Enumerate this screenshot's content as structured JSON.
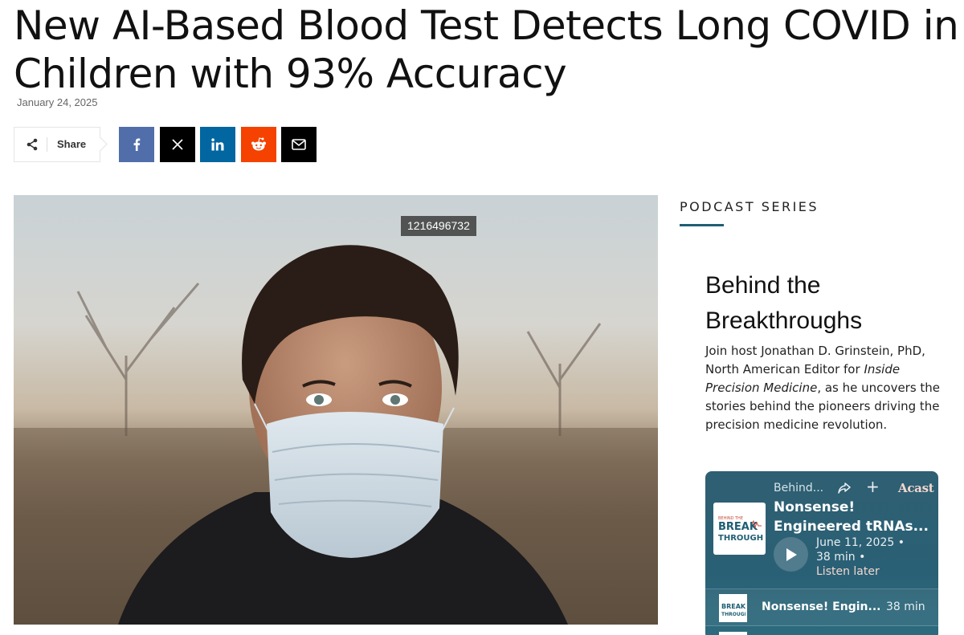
{
  "article": {
    "headline": "New AI-Based Blood Test Detects Long COVID in Children with 93% Accuracy",
    "date": "January 24, 2025"
  },
  "share": {
    "label": "Share",
    "buttons": [
      {
        "name": "facebook",
        "icon": "facebook-icon",
        "color": "#516eab"
      },
      {
        "name": "x",
        "icon": "x-icon",
        "color": "#000000"
      },
      {
        "name": "linkedin",
        "icon": "linkedin-icon",
        "color": "#0266a0"
      },
      {
        "name": "reddit",
        "icon": "reddit-icon",
        "color": "#f54200"
      },
      {
        "name": "email",
        "icon": "mail-icon",
        "color": "#000000"
      }
    ]
  },
  "hero": {
    "image_tag": "1216496732"
  },
  "sidebar": {
    "heading": "PODCAST SERIES",
    "accent": "#1f5e73",
    "podcast": {
      "title": "Behind the Breakthroughs",
      "desc_before": "Join host Jonathan D. Grinstein, PhD, North American Editor for ",
      "desc_italic": "Inside Precision Medicine",
      "desc_after": ", as he uncovers the stories behind the pioneers driving the precision medicine revolution."
    },
    "player": {
      "show": "Behind...",
      "brand": "Acast",
      "episode_line1": "Nonsense!",
      "episode_line2": "Engineered tRNAs...",
      "date": "June 11, 2025",
      "dot1": "•",
      "duration": "38 min",
      "dot2": "•",
      "listen_later": "Listen later",
      "cover_text": [
        "BEHIND THE",
        "BREAK",
        "THROUGHS"
      ],
      "row": {
        "title": "Nonsense! Engin...",
        "duration": "38 min"
      },
      "bg_color": "#2a6075"
    }
  }
}
